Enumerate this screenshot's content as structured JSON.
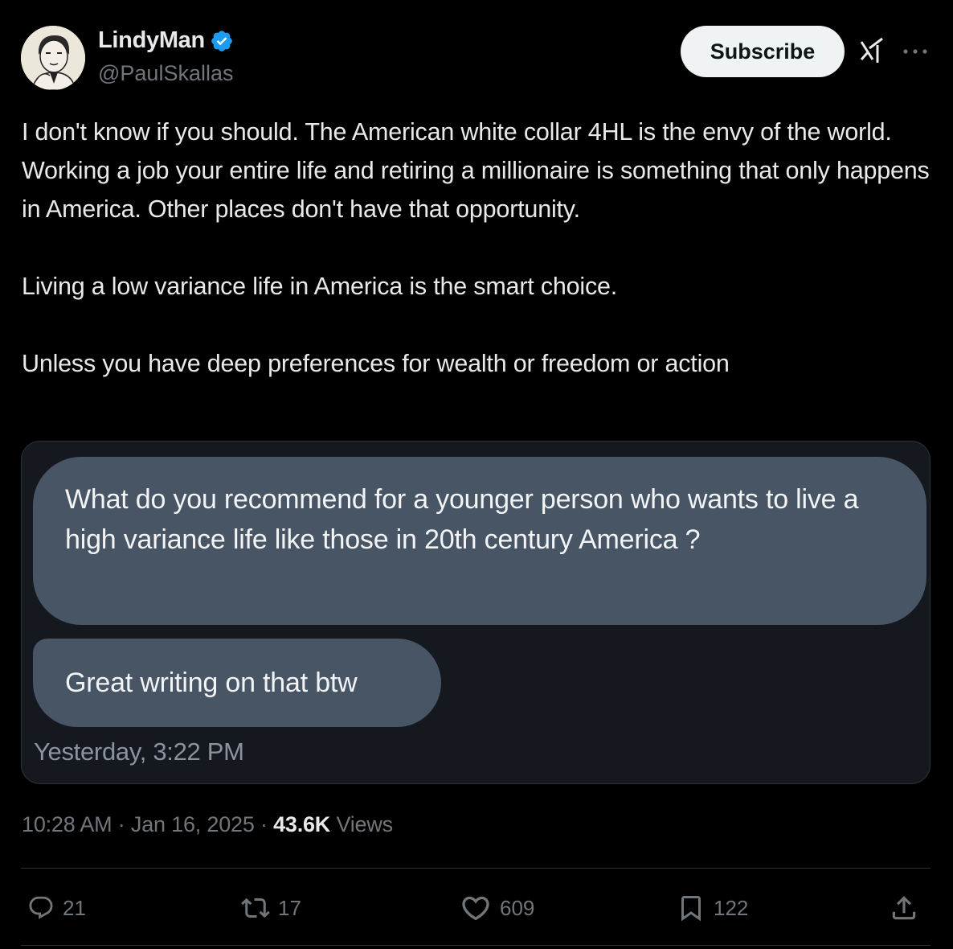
{
  "author": {
    "display_name": "LindyMan",
    "handle": "@PaulSkallas",
    "verified": true
  },
  "header": {
    "subscribe_label": "Subscribe",
    "icons": [
      "grok-icon",
      "more-icon"
    ]
  },
  "tweet": {
    "paragraphs": [
      "I don't know if you should. The American white collar 4HL is the envy of the world. Working a job your entire life and retiring a millionaire is something that only happens in America. Other places don't have that opportunity.",
      "Living a low variance life in America is the smart choice.",
      "Unless you have deep preferences for wealth or freedom or action"
    ]
  },
  "embedded_dm": {
    "messages": [
      "What do you recommend for a younger person who wants to live a high variance life like those in 20th century America ?",
      "Great writing on that btw"
    ],
    "timestamp": "Yesterday, 3:22 PM"
  },
  "meta": {
    "time": "10:28 AM",
    "separator": "·",
    "date": "Jan 16, 2025",
    "views_count": "43.6K",
    "views_label": "Views"
  },
  "actions": {
    "replies": "21",
    "reposts": "17",
    "likes": "609",
    "bookmarks": "122"
  },
  "colors": {
    "background": "#000000",
    "text": "#e7e9ea",
    "secondary_text": "#71767b",
    "verified_badge": "#1d9bf0",
    "bubble": "#475565",
    "card_bg": "#16181f"
  }
}
